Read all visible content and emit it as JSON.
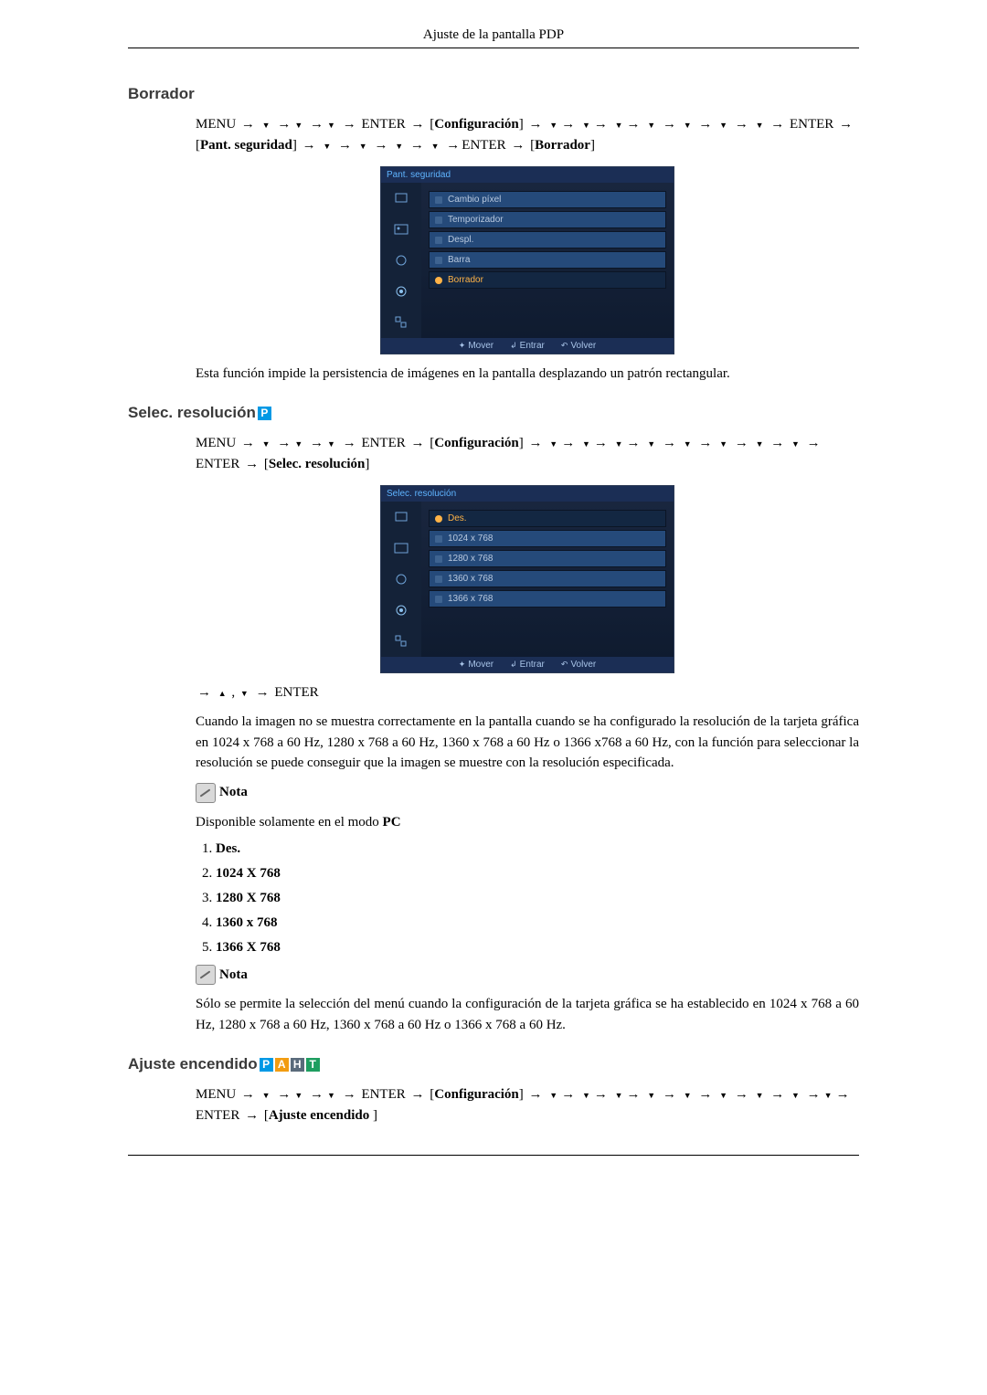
{
  "page_header": "Ajuste de la pantalla PDP",
  "section1": {
    "title": "Borrador",
    "menu_path_pre": "MENU ",
    "enter": "ENTER",
    "config": "Configuración",
    "brackets1": "Pant. seguridad",
    "brackets2": "Borrador",
    "osd": {
      "title": "Pant. seguridad",
      "options": [
        "Cambio píxel",
        "Temporizador",
        "Despl.",
        "Barra",
        "Borrador"
      ],
      "footer": {
        "move": "Mover",
        "enter": "Entrar",
        "return": "Volver"
      }
    },
    "desc": "Esta función impide la persistencia de imágenes en la pantalla desplazando un patrón rectangular."
  },
  "section2": {
    "title": "Selec. resolución",
    "badges": [
      "P"
    ],
    "menu_path_pre": "MENU ",
    "enter": "ENTER",
    "config": "Configuración",
    "brackets1": "Selec. resolución",
    "nav_line": "→ ▲ , ▼ → ENTER",
    "osd": {
      "title": "Selec. resolución",
      "options": [
        "Des.",
        "1024 x 768",
        "1280 x 768",
        "1360 x 768",
        "1366 x 768"
      ],
      "footer": {
        "move": "Mover",
        "enter": "Entrar",
        "return": "Volver"
      }
    },
    "desc": "Cuando la imagen no se muestra correctamente en la pantalla cuando se ha configurado la resolución de la tarjeta gráfica en 1024 x 768 a 60 Hz, 1280 x 768 a 60 Hz, 1360 x 768 a 60 Hz o 1366 x768 a 60 Hz, con la función para seleccionar la resolución se puede conseguir que la imagen se muestre con la resolución especificada.",
    "note_label": "Nota",
    "note1": "Disponible solamente en el modo ",
    "note1_bold": "PC",
    "list": [
      "Des.",
      "1024 X 768",
      "1280 X 768",
      "1360 x 768",
      "1366 X 768"
    ],
    "note2": "Sólo se permite la selección del menú cuando la configuración de la tarjeta gráfica se ha establecido en 1024 x 768 a 60 Hz, 1280 x 768 a 60 Hz, 1360 x 768 a 60 Hz o 1366 x 768 a 60 Hz."
  },
  "section3": {
    "title": "Ajuste encendido",
    "badges": [
      "P",
      "A",
      "H",
      "T"
    ],
    "menu_path_pre": "MENU ",
    "enter": "ENTER",
    "config": "Configuración",
    "brackets1": "Ajuste encendido "
  }
}
